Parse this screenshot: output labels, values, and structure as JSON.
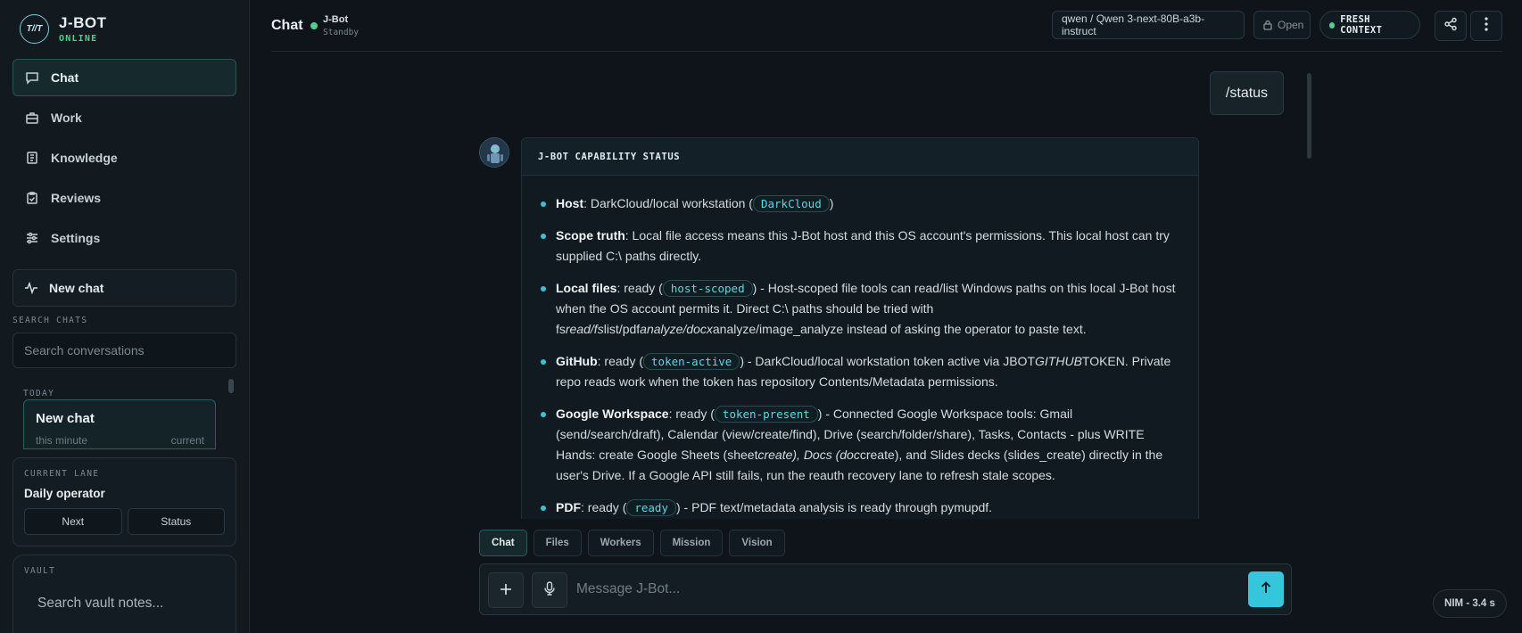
{
  "brand": {
    "logo_text": "T//T",
    "name": "J-BOT",
    "status": "ONLINE"
  },
  "nav": [
    {
      "label": "Chat",
      "icon": "chat-bubble-icon",
      "active": true
    },
    {
      "label": "Work",
      "icon": "briefcase-icon"
    },
    {
      "label": "Knowledge",
      "icon": "book-icon"
    },
    {
      "label": "Reviews",
      "icon": "clipboard-check-icon"
    },
    {
      "label": "Settings",
      "icon": "sliders-icon"
    }
  ],
  "new_chat_label": "New chat",
  "search": {
    "label": "SEARCH CHATS",
    "placeholder": "Search conversations"
  },
  "history": {
    "group": "TODAY",
    "items": [
      {
        "title": "New chat",
        "time": "this minute",
        "tag": "current"
      }
    ]
  },
  "lane": {
    "label": "CURRENT LANE",
    "title": "Daily operator",
    "buttons": [
      "Next",
      "Status"
    ]
  },
  "vault": {
    "label": "VAULT",
    "placeholder": "Search vault notes..."
  },
  "header": {
    "title": "Chat",
    "bot_name": "J-Bot",
    "bot_state": "Standby",
    "model": "qwen / Qwen 3-next-80B-a3b-instruct",
    "open_label": "Open",
    "context_label": "FRESH CONTEXT"
  },
  "messages": {
    "user": "/status",
    "bot_card_title": "J-BOT CAPABILITY STATUS",
    "items": [
      {
        "label": "Host",
        "before": ": DarkCloud/local workstation (",
        "code": "DarkCloud",
        "after": ")"
      },
      {
        "label": "Scope truth",
        "text": ": Local file access means this J-Bot host and this OS account's permissions. This local host can try supplied C:\\ paths directly."
      },
      {
        "label": "Local files",
        "before": ": ready (",
        "code": "host-scoped",
        "after_a": ") - Host-scoped file tools can read/list Windows paths on this local J-Bot host when the OS account permits it. Direct C:\\ paths should be tried with fs",
        "em1": "read/fs",
        "mid1": "list/pdf",
        "em2": "analyze/docx",
        "after_b": "analyze/image_analyze instead of asking the operator to paste text."
      },
      {
        "label": "GitHub",
        "before": ": ready (",
        "code": "token-active",
        "after_a": ") - DarkCloud/local workstation token active via JBOT",
        "em1": "GITHUB",
        "after_b": "TOKEN. Private repo reads work when the token has repository Contents/Metadata permissions."
      },
      {
        "label": "Google Workspace",
        "before": ": ready (",
        "code": "token-present",
        "after_a": ") - Connected Google Workspace tools: Gmail (send/search/draft), Calendar (view/create/find), Drive (search/folder/share), Tasks, Contacts - plus WRITE Hands: create Google Sheets (sheet",
        "em1": "create), Docs (doc",
        "after_b": "create), and Slides decks (slides_create) directly in the user's Drive. If a Google API still fails, run the reauth recovery lane to refresh stale scopes."
      },
      {
        "label": "PDF",
        "before": ": ready (",
        "code": "ready",
        "after": ") - PDF text/metadata analysis is ready through pymupdf."
      }
    ]
  },
  "tabs": [
    "Chat",
    "Files",
    "Workers",
    "Mission",
    "Vision"
  ],
  "composer": {
    "placeholder": "Message J-Bot..."
  },
  "latency": "NIM - 3.4 s",
  "colors": {
    "accent": "#36c6dc",
    "online": "#4fd08f",
    "background": "#0e1419"
  }
}
